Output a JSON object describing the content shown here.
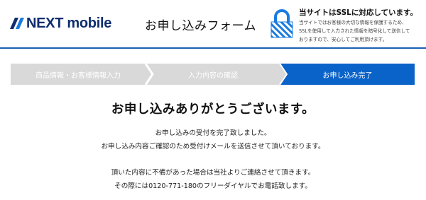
{
  "header": {
    "logo_text": "NEXT mobile",
    "form_title": "お申し込みフォーム",
    "ssl": {
      "title": "当サイトはSSLに対応しています。",
      "desc_lines": [
        "当サイトではお客様の大切な情報を保護するため、",
        "SSLを使用して入力された情報を暗号化して送信して",
        "おりますので、安心してご利用頂けます。"
      ]
    }
  },
  "steps": [
    {
      "label": "商品情報・お客様情報入力",
      "state": "done"
    },
    {
      "label": "入力内容の確認",
      "state": "done"
    },
    {
      "label": "お申し込み完了",
      "state": "current"
    }
  ],
  "main": {
    "thanks": "お申し込みありがとうございます。",
    "messages": [
      "お申し込みの受付を完了致しました。",
      "お申し込み内容ご確認のため受付けメールを送信させて頂いております。",
      "頂いた内容に不備があった場合は当社よりご連絡させて頂きます。",
      "その際には0120-771-180のフリーダイヤルでお電話致します。"
    ]
  },
  "colors": {
    "brand": "#0f2d6e",
    "accent": "#0a63c9",
    "step_inactive": "#d9d9d9"
  }
}
